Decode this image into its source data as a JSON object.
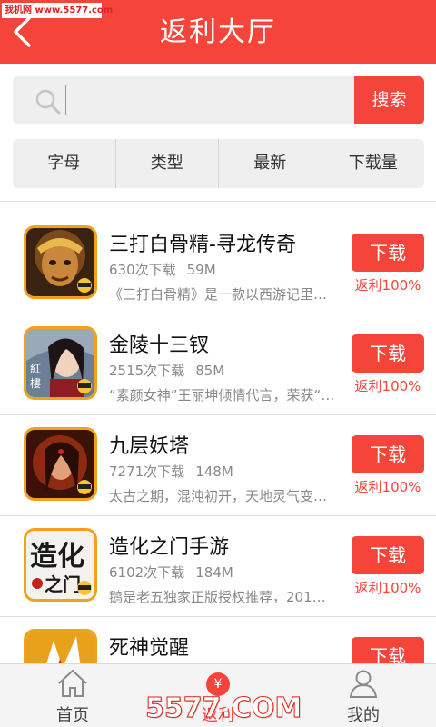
{
  "watermark": "我机网 www.5577.com",
  "header": {
    "title": "返利大厅"
  },
  "search": {
    "placeholder": "",
    "button_label": "搜索"
  },
  "tabs": [
    {
      "label": "字母"
    },
    {
      "label": "类型"
    },
    {
      "label": "最新"
    },
    {
      "label": "下载量"
    }
  ],
  "apps": [
    {
      "name": "三打白骨精-寻龙传奇",
      "downloads": "630次下载",
      "size": "59M",
      "desc": "《三打白骨精》是一款以西游记里…",
      "button": "下载",
      "rebate": "返利100%",
      "icon": "monkey-king-icon"
    },
    {
      "name": "金陵十三钗",
      "downloads": "2515次下载",
      "size": "85M",
      "desc": "“素颜女神”王丽坤倾情代言，荣获“…",
      "button": "下载",
      "rebate": "返利100%",
      "icon": "heroine-portrait-icon"
    },
    {
      "name": "九层妖塔",
      "downloads": "7271次下载",
      "size": "148M",
      "desc": "太古之期，混沌初开，天地灵气变…",
      "button": "下载",
      "rebate": "返利100%",
      "icon": "warrior-portrait-icon"
    },
    {
      "name": "造化之门手游",
      "downloads": "6102次下载",
      "size": "184M",
      "desc": "鹅是老五独家正版授权推荐，201…",
      "button": "下载",
      "rebate": "返利100%",
      "icon": "calligraphy-logo-icon"
    },
    {
      "name": "死神觉醒",
      "downloads": "",
      "size": "",
      "desc": "",
      "button": "下载",
      "rebate": "",
      "icon": "anime-warrior-icon"
    }
  ],
  "bottom_nav": {
    "home": "首页",
    "rebate": "返利",
    "rebate_badge": "¥",
    "mine": "我的"
  },
  "brand_mark": "5577.COM",
  "colors": {
    "accent": "#f5453a",
    "tab_bg": "#efefef",
    "muted_text": "#888888"
  }
}
